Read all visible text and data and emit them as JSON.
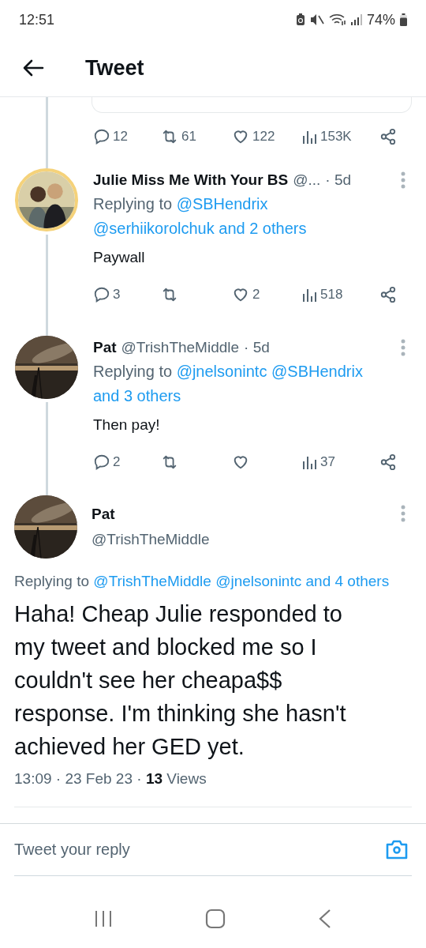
{
  "status_bar": {
    "time": "12:51",
    "battery": "74%"
  },
  "header": {
    "title": "Tweet"
  },
  "parent_tweet_actions": {
    "replies": "12",
    "retweets": "61",
    "likes": "122",
    "views": "153K"
  },
  "replies": [
    {
      "avatar": {
        "kind": "picture",
        "ring": true
      },
      "name": "Julie Miss Me With Your BS",
      "handle": "@...",
      "time": "· 5d",
      "replying_prefix": "Replying to",
      "mentions": [
        "@SBHendrix",
        "@serhiikorolchuk",
        "and 2 others"
      ],
      "text": "Paywall",
      "actions": {
        "replies": "3",
        "likes": "2",
        "views": "518"
      }
    },
    {
      "avatar": {
        "kind": "picture",
        "ring": false
      },
      "name": "Pat",
      "handle": "@TrishTheMiddle",
      "time": "· 5d",
      "replying_prefix": "Replying to",
      "mentions": [
        "@jnelsonintc",
        "@SBHendrix",
        "and 3 others"
      ],
      "text": "Then pay!",
      "actions": {
        "replies": "2",
        "views": "37"
      }
    }
  ],
  "main_tweet": {
    "name": "Pat",
    "handle": "@TrishTheMiddle",
    "replying_prefix": "Replying to",
    "mentions": [
      "@TrishTheMiddle",
      "@jnelsonintc",
      "and 4 others"
    ],
    "text": "Haha! Cheap Julie responded to my tweet and blocked me so I couldn't see her cheapa$$ response. I'm thinking she hasn't achieved her GED yet.",
    "meta": "13:09 · 23 Feb 23 · **13** Views"
  },
  "reply_bar": {
    "placeholder": "Tweet your reply"
  }
}
